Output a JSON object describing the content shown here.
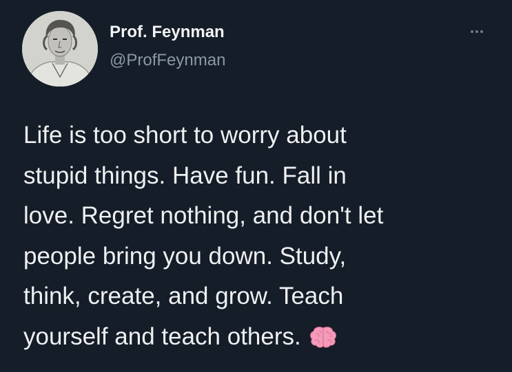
{
  "author": {
    "name": "Prof. Feynman",
    "handle": "@ProfFeynman",
    "avatar_icon": "portrait-avatar"
  },
  "menu": {
    "icon": "more-options-icon"
  },
  "tweet": {
    "lines": [
      "Life is too short to worry about",
      "stupid things. Have fun. Fall in",
      "love. Regret nothing, and don't let",
      "people bring you down. Study,",
      "think, create, and grow. Teach",
      "yourself and teach others."
    ],
    "emoji": "brain-icon"
  },
  "colors": {
    "background": "#151d29",
    "text": "#eef0f1",
    "secondary_text": "#8b98a5",
    "brain": "#f59ab9"
  }
}
